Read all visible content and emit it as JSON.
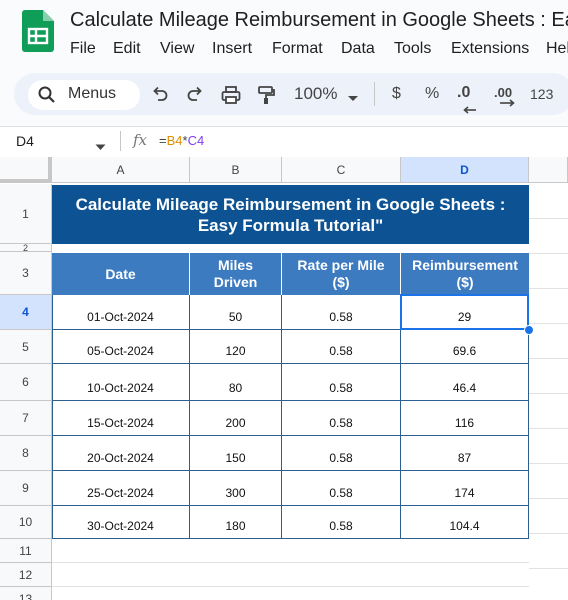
{
  "app": {
    "title": "Calculate Mileage Reimbursement in Google Sheets : Ea",
    "menu": [
      "File",
      "Edit",
      "View",
      "Insert",
      "Format",
      "Data",
      "Tools",
      "Extensions",
      "Hel"
    ]
  },
  "toolbar": {
    "search_label": "Menus",
    "zoom": "100%",
    "currency": "$",
    "percent": "%",
    "decrease_decimal": ".0",
    "number_format": "123"
  },
  "formula_bar": {
    "cell_ref": "D4",
    "fx": "fx",
    "formula_eq": "=",
    "formula_ref1": "B4",
    "formula_op": "*",
    "formula_ref2": "C4"
  },
  "sheet": {
    "columns": [
      "A",
      "B",
      "C",
      "D"
    ],
    "rows": [
      "1",
      "2",
      "3",
      "4",
      "5",
      "6",
      "7",
      "8",
      "9",
      "10",
      "11",
      "12",
      "13"
    ],
    "banner": "Calculate Mileage Reimbursement in Google Sheets : Easy Formula Tutorial\"",
    "headers": [
      "Date",
      "Miles Driven",
      "Rate per Mile ($)",
      "Reimbursement ($)"
    ],
    "data": [
      [
        "01-Oct-2024",
        "50",
        "0.58",
        "29"
      ],
      [
        "05-Oct-2024",
        "120",
        "0.58",
        "69.6"
      ],
      [
        "10-Oct-2024",
        "80",
        "0.58",
        "46.4"
      ],
      [
        "15-Oct-2024",
        "200",
        "0.58",
        "116"
      ],
      [
        "20-Oct-2024",
        "150",
        "0.58",
        "87"
      ],
      [
        "25-Oct-2024",
        "300",
        "0.58",
        "174"
      ],
      [
        "30-Oct-2024",
        "180",
        "0.58",
        "104.4"
      ]
    ]
  },
  "colors": {
    "banner_bg": "#0d5394",
    "header_bg": "#3d7bc1",
    "selection": "#1a73e8",
    "sheets_green": "#0f9d58"
  }
}
